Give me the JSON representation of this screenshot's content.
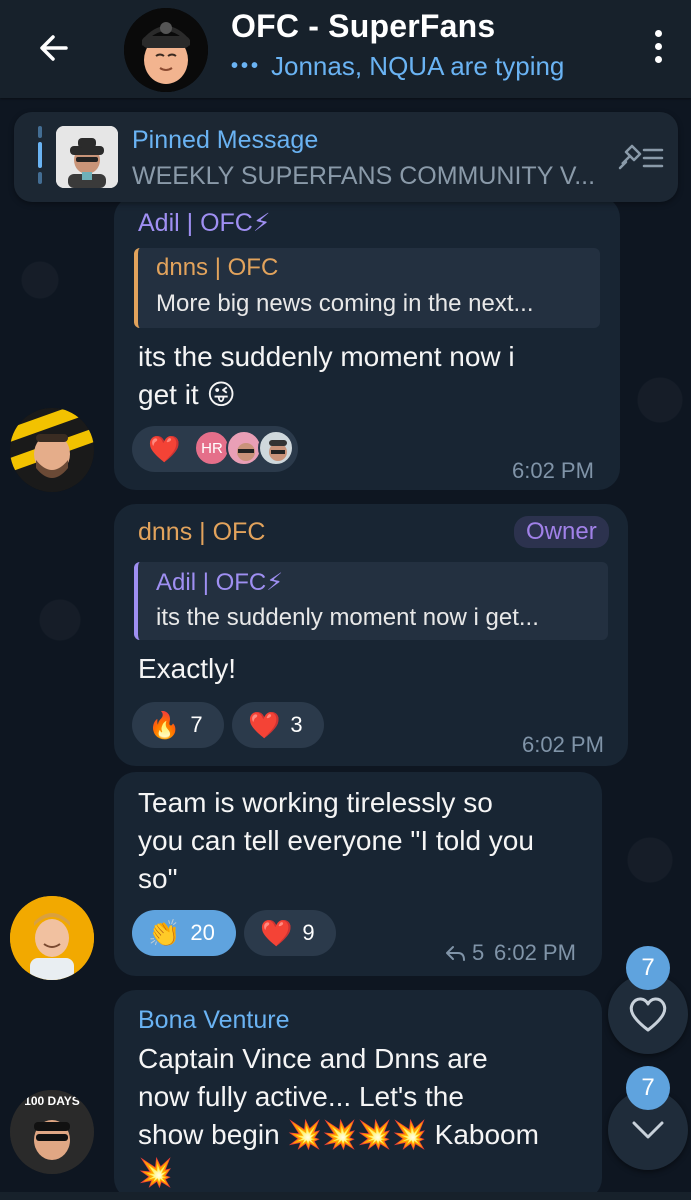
{
  "header": {
    "title": "OFC - SuperFans",
    "typing_dots": "•••",
    "typing": "Jonnas, NQUA are typing"
  },
  "pinned": {
    "title": "Pinned Message",
    "text": "WEEKLY SUPERFANS COMMUNITY V..."
  },
  "messages": [
    {
      "sender": "Adil | OFC⚡",
      "sender_color": "#9f8ff2",
      "reply_name": "dnns | OFC",
      "reply_text": "More big news coming in the next...",
      "reply_color": "#e2a35c",
      "text_line1": "its the suddenly moment now i",
      "text_line2": "get it 😜",
      "reaction_emoji": "❤️",
      "reaction_user_initials": "HR",
      "time": "6:02 PM"
    },
    {
      "sender": "dnns | OFC",
      "sender_color": "#e2a35c",
      "badge": "Owner",
      "reply_name": "Adil | OFC⚡",
      "reply_text": "its the suddenly moment now i get...",
      "reply_color": "#9f8ff2",
      "text": "Exactly!",
      "reactions": [
        {
          "emoji": "🔥",
          "count": "7"
        },
        {
          "emoji": "❤️",
          "count": "3"
        }
      ],
      "time": "6:02 PM"
    },
    {
      "text_line1": "Team is working tirelessly so",
      "text_line2": "you can tell everyone \"I told you",
      "text_line3": "so\"",
      "reactions": [
        {
          "emoji": "👏",
          "count": "20"
        },
        {
          "emoji": "❤️",
          "count": "9"
        }
      ],
      "replies": "5",
      "time": "6:02 PM"
    },
    {
      "sender": "Bona Venture",
      "sender_color": "#6ab3f3",
      "text_line1": "Captain Vince and Dnns are",
      "text_line2": "now fully active... Let's the",
      "text_line3": "show begin 💥💥💥💥 Kaboom",
      "text_line4": "💥",
      "avatar_caption": "100 DAYS"
    }
  ],
  "fabs": {
    "reactions_badge": "7",
    "mentions_badge": "7"
  },
  "colors": {
    "accent": "#6ab3f3",
    "bubble": "#182533",
    "background": "#0e1621"
  }
}
